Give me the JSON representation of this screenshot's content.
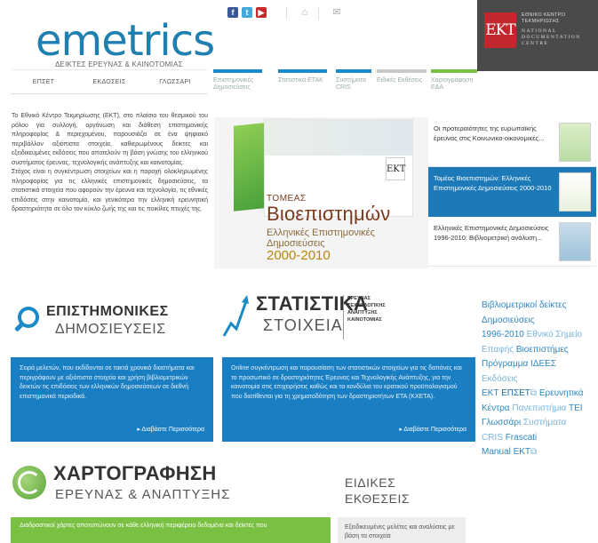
{
  "header": {
    "logo_text": "metrics",
    "logo_e": "e",
    "logo_subtitle": "ΔΕΙΚΤΕΣ ΕΡΕΥΝΑΣ & ΚΑΙΝΟΤΟΜΙΑΣ",
    "social": [
      {
        "icon": "facebook-icon",
        "glyph": "f"
      },
      {
        "icon": "twitter-icon",
        "glyph": "t"
      },
      {
        "icon": "youtube-icon",
        "glyph": "▶"
      }
    ],
    "home_glyph": "⌂",
    "mail_glyph": "✉",
    "ekt": {
      "mark": "EKT",
      "greek": "ΕΘΝΙΚΟ ΚΕΝΤΡΟ ΤΕΚΜΗΡΙΩΣΗΣ",
      "english": "NATIONAL DOCUMENTATION CENTRE"
    }
  },
  "left_nav": [
    "ΕΠΣΕΤ",
    "ΕΚΔΟΣΕΙΣ",
    "ΓΛΩΣΣΑΡΙ"
  ],
  "categories": [
    {
      "label": "Επιστημονικές Δημοσιεύσεις",
      "color": "#1a8bc7"
    },
    {
      "label": "Στατιστικά ΕΤΑΚ",
      "color": "#1a8bc7"
    },
    {
      "label": "Συστήματα CRIS",
      "color": "#1a8bc7"
    },
    {
      "label": "Ειδικές Εκθέσεις",
      "color": "#c9c9c9"
    },
    {
      "label": "Χαρτογράφηση Ε&Α",
      "color": "#7ac043"
    }
  ],
  "intro": {
    "p1": "Το Εθνικό Κέντρο Τεκμηρίωσης (ΕΚΤ), στο πλαίσιο του θεσμικού του ρόλου για συλλογή, οργάνωση και διάθεση επιστημονικής πληροφορίας & περιεχομένου, παρουσιάζει σε ένα ψηφιακό περιβάλλον αξιόπιστα στοιχεία, καθιερωμένους δείκτες και εξειδικευμένες εκδόσεις που αποτελούν τη βάση γνώσης του ελληνικού συστήματος έρευνας, τεχνολογικής ανάπτυξης και καινοτομίας.",
    "p2": "Στόχος είναι η συγκέντρωση στοιχείων και η παροχή ολοκληρωμένης πληροφορίας για τις ελληνικές επιστημονικές δημοσιεύσεις, τα στατιστικά στοιχεία που αφορούν την έρευνα και τεχνολογία, τις εθνικές επιδόσεις στην καινοτομία, και γενικότερα την ελληνική ερευνητική δραστηριότητα σε όλο τον κύκλο ζωής της και τις ποικίλες πτυχές της."
  },
  "feature": {
    "ekt_mark": "EKT",
    "line1": "ΤΟΜΕΑΣ",
    "line2": "Βιοεπιστημών",
    "line3": "Ελληνικές Επιστημονικές Δημοσιεύσεις",
    "line4": "2000-2010"
  },
  "slides": [
    {
      "text": "Οι προτεραιότητες της ευρωπαϊκής έρευνας στις Κοινωνικο-οικονομικές...",
      "active": false
    },
    {
      "text": "Τομέας Βιοεπιστημών: Ελληνικές Επιστημονικές Δημοσιεύσεις 2000-2010",
      "active": true
    },
    {
      "text": "Ελληνικές Επιστημονικές Δημοσιεύσεις 1996-2010: Βιβλιομετρική ανάλυση...",
      "active": false
    }
  ],
  "publications": {
    "title_a": "ΕΠΙΣΤΗΜΟΝΙΚΕΣ",
    "title_b": "ΔΗΜΟΣΙΕΥΣΕΙΣ",
    "text": "Σειρά μελετών, που εκδίδονται σε τακτά χρονικά διαστήματα και περιγράφουν με αξιόπιστα στοιχεία και χρήση βιβλιομετρικών δεικτών τις επιδόσεις των ελληνικών δημοσιεύσεων σε διεθνή επιστημονικά περιοδικά.",
    "more": "▸ Διαβάστε Περισσότερα"
  },
  "statistics": {
    "title_a": "ΣΤΑΤΙΣΤΙΚΑ",
    "title_b": "ΣΤΟΙΧΕΙΑ",
    "box": [
      "ΕΡΕΥΝΑΣ",
      "ΤΕΧΝΟΛΟΓΙΚΗΣ",
      "ΑΝΑΠΤΥΞΗΣ",
      "ΚΑΙΝΟΤΟΜΙΑΣ"
    ],
    "text": "Online συγκέντρωση και παρουσίαση των στατιστικών στοιχείων για τις δαπάνες και το προσωπικό σε δραστηριότητες Έρευνας και Τεχνολογικής Ανάπτυξης, για την καινοτομία στις επιχειρήσεις καθώς και τα κονδύλια του κρατικού προϋπολογισμού που διατίθενται για τη χρηματοδότηση των δραστηριοτήτων ΕΤΑ (ΚΧΕΤΑ).",
    "more": "▸ Διαβάστε Περισσότερα"
  },
  "tags": [
    {
      "t": "Βιβλιομετρικοί δείκτες",
      "c": "n"
    },
    {
      "t": "Δημοσιεύσεις",
      "c": "n"
    },
    {
      "t": "1996-2010",
      "c": "n"
    },
    {
      "t": "Εθνικό Σημείο",
      "c": "lt"
    },
    {
      "t": "Επαφής",
      "c": "lt"
    },
    {
      "t": "Βιοεπιστήμες",
      "c": "n"
    },
    {
      "t": "Πρόγραμμα ΙΔΕΕΣ",
      "c": "n"
    },
    {
      "t": "Εκδόσεις",
      "c": "lt"
    },
    {
      "t": "ΕΚΤ",
      "c": "n"
    },
    {
      "t": "ΕΠΣΕΤ",
      "c": "dk"
    },
    {
      "t": "Ερευνητικά",
      "c": "n"
    },
    {
      "t": "Κέντρα",
      "c": "n"
    },
    {
      "t": "Πανεπιστήμια",
      "c": "lt"
    },
    {
      "t": "ΤΕΙ",
      "c": "n"
    },
    {
      "t": "Γλωσσάρι",
      "c": "n"
    },
    {
      "t": "Συστήματα",
      "c": "lt"
    },
    {
      "t": "CRIS",
      "c": "lt"
    },
    {
      "t": "Frascati",
      "c": "n"
    },
    {
      "t": "Manual",
      "c": "n"
    },
    {
      "t": "ΕΚΤ",
      "c": "n"
    }
  ],
  "mapping": {
    "title_a": "ΧΑΡΤΟΓΡΑΦΗΣΗ",
    "title_b": "ΕΡΕΥΝΑΣ & ΑΝΑΠΤΥΞΗΣ",
    "text": "Διαδραστικοί χάρτες αποτυπώνουν σε κάθε ελληνική περιφέρεια δεδομένα και δείκτες που"
  },
  "reports": {
    "title_a": "ΕΙΔΙΚΕΣ",
    "title_b": "ΕΚΘΕΣΕΙΣ",
    "text": "Εξειδικευμένες μελέτες και αναλύσεις με βάση τα στοιχεία"
  }
}
